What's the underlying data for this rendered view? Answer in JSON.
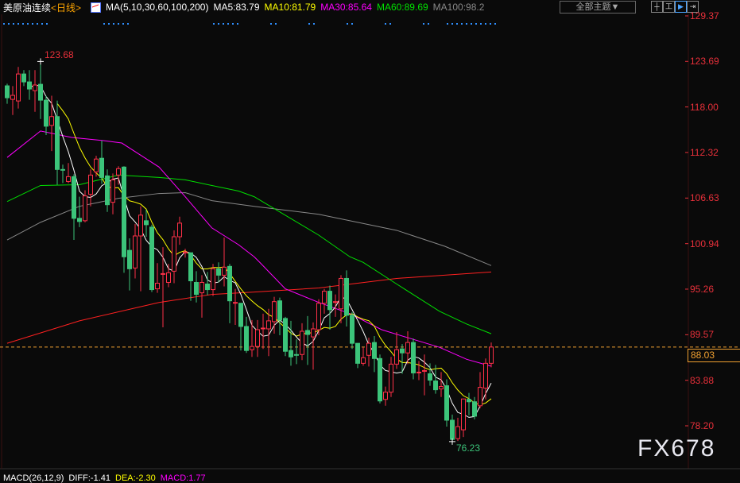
{
  "header": {
    "title": "美原油连续",
    "period": "<日线>",
    "ma_params": "MA(5,10,30,60,100,200)",
    "ma5": "MA5:83.79",
    "ma10": "MA10:81.79",
    "ma30": "MA30:85.64",
    "ma60": "MA60:89.69",
    "ma100": "MA100:98.2",
    "theme_button": "全部主题▼",
    "tools": [
      "crosshair",
      "range",
      "cursor",
      "exit"
    ]
  },
  "colors": {
    "up": "#ff3048",
    "down": "#3cc47a",
    "ma5": "#ffffff",
    "ma10": "#ffff00",
    "ma30": "#ff00ff",
    "ma60": "#00e000",
    "ma100": "#888888",
    "ma200": "#ff2020",
    "axis": "#e8303a",
    "current": "#f0a030"
  },
  "chart_data": {
    "type": "candlestick",
    "price_axis_labels": [
      "129.37",
      "123.69",
      "118.00",
      "112.32",
      "106.63",
      "100.94",
      "95.26",
      "89.57",
      "83.88",
      "78.20"
    ],
    "ylim": [
      78.2,
      129.37
    ],
    "current_price": "88.03",
    "high_annotation": {
      "index": 6,
      "label": "123.68"
    },
    "low_annotation": {
      "index": 80,
      "label": "76.23"
    },
    "ohlc": [
      [
        120.64,
        120.9,
        118.4,
        119.15
      ],
      [
        118.95,
        120.6,
        117.0,
        119.45
      ],
      [
        118.75,
        123.0,
        117.8,
        122.12
      ],
      [
        122.12,
        122.6,
        120.6,
        121.13
      ],
      [
        121.13,
        122.6,
        118.9,
        120.24
      ],
      [
        120.04,
        122.6,
        117.4,
        120.74
      ],
      [
        120.83,
        123.68,
        116.5,
        118.85
      ],
      [
        118.85,
        119.4,
        114.5,
        115.6
      ],
      [
        115.7,
        119.4,
        112.5,
        116.8
      ],
      [
        116.8,
        118.8,
        108.3,
        110.2
      ],
      [
        110.2,
        110.8,
        108.5,
        110.1
      ],
      [
        108.7,
        111.0,
        108.5,
        109.3
      ],
      [
        109.3,
        109.6,
        101.4,
        104.1
      ],
      [
        104.1,
        106.8,
        103.0,
        103.7
      ],
      [
        103.8,
        107.6,
        103.6,
        106.9
      ],
      [
        107.1,
        110.2,
        105.6,
        109.5
      ],
      [
        109.9,
        111.9,
        109.3,
        111.5
      ],
      [
        111.6,
        113.8,
        108.4,
        109.2
      ],
      [
        109.4,
        110.2,
        104.9,
        105.8
      ],
      [
        106.1,
        109.7,
        104.6,
        108.9
      ],
      [
        109.5,
        110.6,
        108.3,
        110.3
      ],
      [
        110.5,
        110.6,
        97.3,
        99.3
      ],
      [
        100.1,
        101.6,
        95.1,
        97.8
      ],
      [
        97.9,
        103.4,
        96.6,
        101.9
      ],
      [
        101.9,
        105.6,
        95.0,
        104.5
      ],
      [
        103.8,
        105.2,
        101.8,
        103.3
      ],
      [
        103.0,
        103.3,
        94.9,
        95.2
      ],
      [
        95.3,
        98.5,
        94.8,
        96.0
      ],
      [
        97.1,
        100.5,
        90.5,
        97.2
      ],
      [
        96.1,
        98.4,
        95.5,
        97.3
      ],
      [
        97.5,
        102.6,
        96.0,
        101.8
      ],
      [
        101.8,
        104.3,
        100.8,
        103.5
      ],
      [
        99.8,
        100.3,
        99.2,
        99.9
      ],
      [
        99.8,
        99.8,
        93.8,
        96.3
      ],
      [
        96.1,
        97.5,
        93.6,
        94.6
      ],
      [
        94.8,
        97.0,
        91.7,
        96.1
      ],
      [
        95.9,
        97.4,
        94.5,
        95.2
      ],
      [
        95.2,
        98.4,
        94.4,
        97.8
      ],
      [
        97.8,
        98.6,
        96.1,
        97.0
      ],
      [
        97.0,
        101.7,
        95.6,
        98.0
      ],
      [
        98.1,
        98.4,
        91.0,
        93.8
      ],
      [
        93.5,
        95.3,
        90.8,
        93.6
      ],
      [
        93.5,
        93.5,
        87.6,
        90.6
      ],
      [
        90.6,
        91.8,
        87.3,
        87.6
      ],
      [
        87.7,
        91.4,
        86.8,
        88.1
      ],
      [
        88.1,
        91.4,
        86.8,
        90.2
      ],
      [
        90.4,
        92.2,
        87.8,
        90.4
      ],
      [
        90.3,
        92.8,
        86.9,
        91.3
      ],
      [
        91.2,
        94.3,
        89.7,
        93.7
      ],
      [
        93.8,
        94.2,
        89.5,
        91.4
      ],
      [
        91.6,
        91.8,
        86.9,
        87.5
      ],
      [
        87.6,
        91.3,
        85.7,
        86.8
      ],
      [
        87.1,
        89.0,
        85.9,
        87.0
      ],
      [
        87.1,
        91.0,
        86.4,
        90.0
      ],
      [
        90.1,
        91.9,
        85.8,
        89.6
      ],
      [
        89.3,
        91.1,
        85.2,
        90.3
      ],
      [
        90.2,
        94.0,
        89.5,
        93.5
      ],
      [
        93.5,
        95.3,
        92.2,
        95.0
      ],
      [
        95.0,
        95.7,
        90.2,
        92.7
      ],
      [
        93.7,
        94.6,
        91.8,
        93.7
      ],
      [
        92.8,
        97.0,
        91.0,
        96.6
      ],
      [
        96.6,
        97.6,
        90.6,
        92.0
      ],
      [
        92.0,
        92.4,
        87.8,
        88.5
      ],
      [
        88.5,
        88.5,
        85.4,
        86.0
      ],
      [
        86.0,
        88.0,
        85.7,
        86.7
      ],
      [
        87.0,
        89.2,
        85.6,
        88.5
      ],
      [
        88.6,
        89.4,
        84.9,
        86.6
      ],
      [
        86.6,
        87.1,
        81.0,
        81.3
      ],
      [
        81.5,
        83.1,
        80.7,
        82.4
      ],
      [
        82.4,
        86.8,
        81.8,
        85.9
      ],
      [
        85.9,
        89.9,
        85.3,
        87.7
      ],
      [
        87.8,
        88.4,
        84.7,
        87.3
      ],
      [
        87.3,
        90.0,
        85.9,
        88.6
      ],
      [
        88.6,
        89.1,
        84.0,
        84.8
      ],
      [
        84.9,
        86.3,
        83.9,
        84.9
      ],
      [
        85.0,
        87.1,
        82.0,
        85.1
      ],
      [
        84.7,
        86.0,
        83.2,
        83.9
      ],
      [
        83.8,
        85.8,
        82.2,
        82.7
      ],
      [
        82.8,
        84.9,
        81.8,
        83.1
      ],
      [
        83.2,
        84.0,
        78.1,
        78.9
      ],
      [
        78.9,
        79.6,
        76.23,
        76.5
      ],
      [
        76.6,
        79.2,
        76.3,
        78.1
      ],
      [
        77.7,
        81.6,
        76.8,
        81.55
      ],
      [
        81.5,
        82.3,
        79.5,
        81.2
      ],
      [
        81.2,
        81.8,
        79.0,
        79.4
      ],
      [
        80.7,
        84.9,
        80.4,
        83.0
      ],
      [
        82.9,
        86.6,
        81.5,
        86.0
      ],
      [
        86.0,
        88.6,
        85.5,
        88.03
      ]
    ],
    "ma_lines": {
      "ma30": [
        [
          0,
          111.7
        ],
        [
          6,
          115.0
        ],
        [
          11.6,
          114.2
        ],
        [
          17.3,
          113.8
        ],
        [
          20.6,
          113.5
        ],
        [
          24.4,
          111.8
        ],
        [
          27.3,
          110.5
        ],
        [
          32,
          106.8
        ],
        [
          36.8,
          102.9
        ],
        [
          41.6,
          100.8
        ],
        [
          44.4,
          99.3
        ],
        [
          45.4,
          98.6
        ],
        [
          50,
          95.3
        ],
        [
          56,
          93.6
        ],
        [
          61.6,
          92.2
        ],
        [
          67.3,
          90.2
        ],
        [
          72,
          89.2
        ],
        [
          77.7,
          88.0
        ],
        [
          82.6,
          86.5
        ],
        [
          87,
          85.64
        ]
      ],
      "ma60": [
        [
          0,
          106.2
        ],
        [
          6,
          108.2
        ],
        [
          13,
          108.3
        ],
        [
          20,
          109.5
        ],
        [
          27.3,
          109.2
        ],
        [
          32,
          108.9
        ],
        [
          41.6,
          107.5
        ],
        [
          44.4,
          106.8
        ],
        [
          56,
          102.0
        ],
        [
          61.6,
          99.3
        ],
        [
          64,
          98.6
        ],
        [
          70,
          95.9
        ],
        [
          77.7,
          92.5
        ],
        [
          82.6,
          90.9
        ],
        [
          87,
          89.69
        ]
      ],
      "ma100": [
        [
          0,
          101.4
        ],
        [
          6,
          103.6
        ],
        [
          13,
          105.6
        ],
        [
          20,
          106.6
        ],
        [
          27.3,
          107.2
        ],
        [
          32,
          107.3
        ],
        [
          36.8,
          106.3
        ],
        [
          44.4,
          105.6
        ],
        [
          56,
          104.6
        ],
        [
          70,
          102.6
        ],
        [
          78.7,
          100.6
        ],
        [
          87,
          98.2
        ]
      ],
      "ma200": [
        [
          0,
          88.5
        ],
        [
          13,
          91.3
        ],
        [
          27.3,
          93.6
        ],
        [
          36.8,
          94.6
        ],
        [
          44.4,
          94.9
        ],
        [
          56,
          95.4
        ],
        [
          70,
          96.6
        ],
        [
          87,
          97.4
        ]
      ]
    }
  },
  "watermark": "FX678",
  "macd": {
    "params": "MACD(26,12,9)",
    "diff": "DIFF:-1.41",
    "dea": "DEA:-2.30",
    "macd": "MACD:1.77"
  }
}
